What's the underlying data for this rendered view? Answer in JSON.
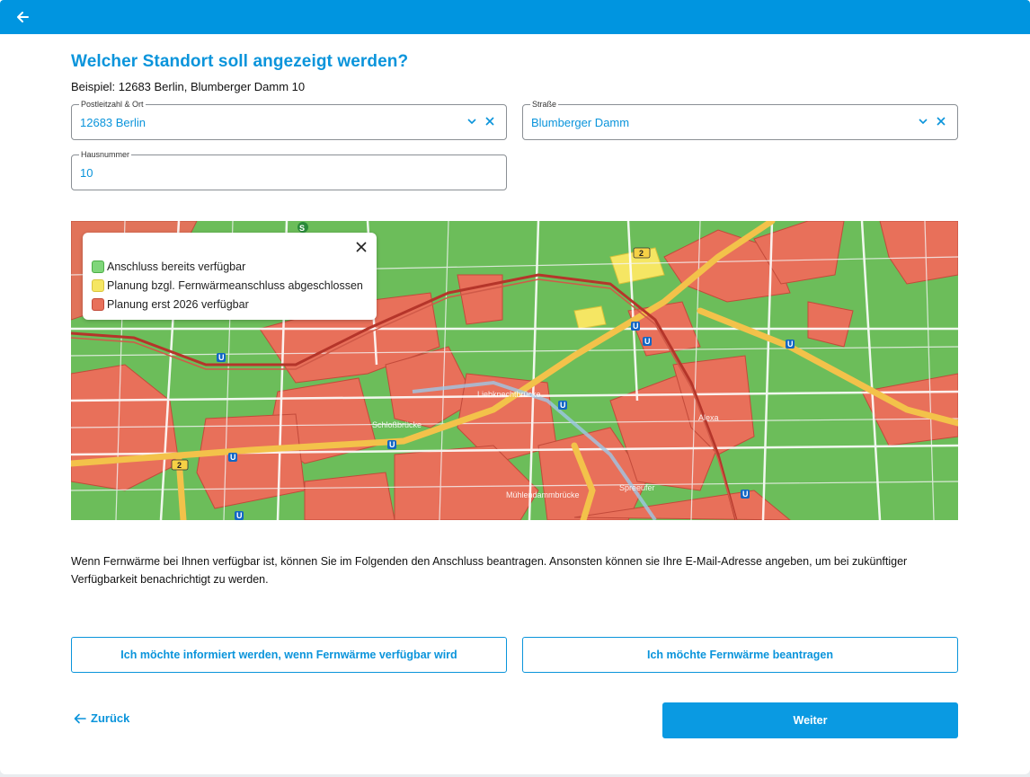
{
  "header": {
    "back_icon": "arrow-left-icon"
  },
  "form": {
    "title": "Welcher Standort soll angezeigt werden?",
    "example": "Beispiel: 12683 Berlin, Blumberger Damm 10",
    "postal": {
      "label": "Postleitzahl & Ort",
      "value": "12683 Berlin"
    },
    "street": {
      "label": "Straße",
      "value": "Blumberger Damm"
    },
    "housenumber": {
      "label": "Hausnummer",
      "value": "10"
    }
  },
  "map": {
    "legend": [
      {
        "label": "Anschluss bereits verfügbar",
        "color": "#7fd67a"
      },
      {
        "label": "Planung bzgl. Fernwärmeanschluss abgeschlossen",
        "color": "#f5e663"
      },
      {
        "label": "Planung erst 2026 verfügbar",
        "color": "#e8705a"
      }
    ],
    "street_labels": [
      "Liebknechtbrücke",
      "Schloßbrücke",
      "Mühlendammbrücke",
      "Alexa",
      "Spreeufer"
    ],
    "route_badge": "2",
    "colors": {
      "available": "#6cbd5a",
      "planned": "#f5e663",
      "later": "#e8705a",
      "road": "#f3c24a"
    }
  },
  "info_text": "Wenn Fernwärme bei Ihnen verfügbar ist, können Sie im Folgenden den Anschluss beantragen. Ansonsten können sie Ihre E-Mail-Adresse angeben, um bei zukünftiger Verfügbarkeit benachrichtigt zu werden.",
  "actions": {
    "inform": "Ich möchte informiert werden, wenn Fernwärme verfügbar wird",
    "apply": "Ich möchte Fernwärme beantragen",
    "back": "Zurück",
    "next": "Weiter"
  },
  "colors": {
    "accent": "#0095e0",
    "text": "#111111",
    "border": "#8a8f94"
  }
}
